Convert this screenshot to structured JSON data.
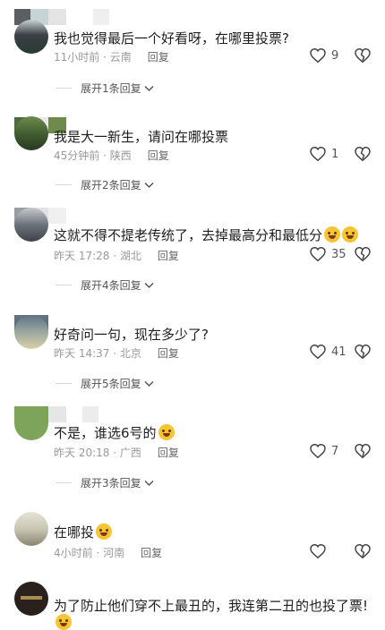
{
  "comments": [
    {
      "text": "我也觉得最后一个好看呀，在哪里投票?",
      "time": "11小时前 · 云南",
      "reply": "回复",
      "likes": "9",
      "expand": "展开1条回复",
      "avatar_colors": [
        "#3a3f45",
        "#6f8f7a"
      ]
    },
    {
      "text": "我是大一新生，请问在哪投票",
      "time": "45分钟前 · 陕西",
      "reply": "回复",
      "likes": "1",
      "expand": "展开2条回复",
      "avatar_colors": [
        "#4a6b3a",
        "#8fa36a"
      ]
    },
    {
      "text": "这就不得不提老传统了，去掉最高分和最低分",
      "time": "昨天 17:28 · 湖北",
      "reply": "回复",
      "likes": "35",
      "expand": "展开4条回复",
      "avatar_colors": [
        "#5a5f66",
        "#9aa0a8"
      ]
    },
    {
      "text": "好奇问一句，现在多少了?",
      "time": "昨天 14:37 · 北京",
      "reply": "回复",
      "likes": "41",
      "expand": "展开5条回复",
      "avatar_colors": [
        "#556a7a",
        "#c9c2a8"
      ]
    },
    {
      "text": "不是，谁选6号的",
      "time": "昨天 20:18 · 广西",
      "reply": "回复",
      "likes": "7",
      "expand": "展开3条回复",
      "avatar_colors": [
        "#7ea35a",
        "#a8c27a"
      ]
    },
    {
      "text": "在哪投",
      "time": "4小时前 · 河南",
      "reply": "回复",
      "likes": "",
      "expand": "",
      "avatar_colors": [
        "#c9c6b5",
        "#8a8570"
      ]
    },
    {
      "text": "为了防止他们穿不上最丑的，我连第二丑的也投了票!",
      "time": "",
      "reply": "",
      "likes": "",
      "expand": "",
      "avatar_colors": [
        "#2b211c",
        "#5a4630"
      ]
    }
  ]
}
